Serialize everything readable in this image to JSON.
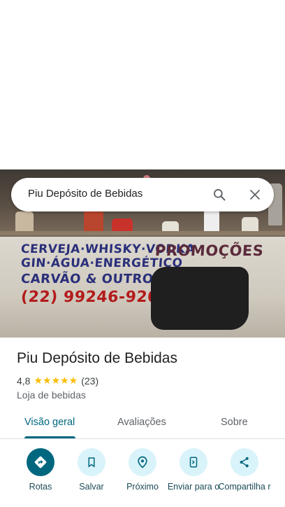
{
  "search": {
    "query": "Piu Depósito de Bebidas"
  },
  "photo": {
    "lines": [
      "CERVEJA·WHISKY·VODKA",
      "GIN·ÁGUA·ENERGÉTICO",
      "CARVÃO & OUTROS",
      "(22) 99246-9204"
    ],
    "promo": "PROMOÇÕES"
  },
  "place": {
    "name": "Piu Depósito de Bebidas",
    "rating": "4,8",
    "stars": "★★★★★",
    "reviews": "(23)",
    "category": "Loja de bebidas"
  },
  "tabs": [
    {
      "label": "Visão geral",
      "active": true
    },
    {
      "label": "Avaliações",
      "active": false
    },
    {
      "label": "Sobre",
      "active": false
    }
  ],
  "actions": [
    {
      "label": "Rotas",
      "icon": "directions-icon"
    },
    {
      "label": "Salvar",
      "icon": "bookmark-icon"
    },
    {
      "label": "Próximo",
      "icon": "nearby-icon"
    },
    {
      "label": "Enviar para o",
      "icon": "send-to-phone-icon"
    },
    {
      "label": "Compartilha r",
      "icon": "share-icon"
    }
  ],
  "colors": {
    "accent": "#00677f",
    "action_bg": "#d9f3fa",
    "star": "#fbbc04"
  }
}
